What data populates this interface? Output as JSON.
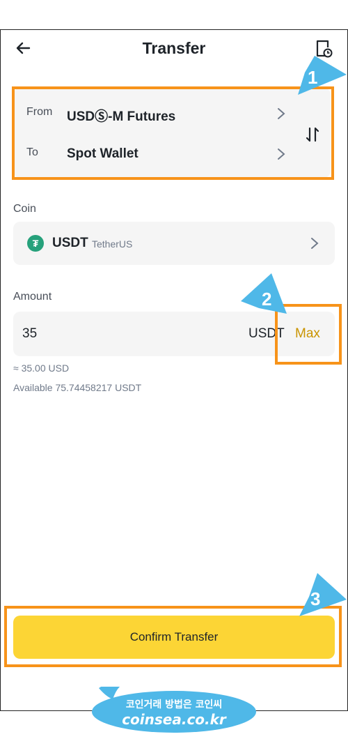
{
  "header": {
    "title": "Transfer",
    "back_icon": "arrow-left-icon",
    "history_icon": "history-icon"
  },
  "transfer": {
    "from_label": "From",
    "from_value": "USDⓈ-M Futures",
    "to_label": "To",
    "to_value": "Spot Wallet",
    "swap_icon": "swap-vertical-icon"
  },
  "coin": {
    "label": "Coin",
    "symbol": "USDT",
    "name": "TetherUS",
    "logo_glyph": "₮",
    "logo_color": "#26a17b"
  },
  "amount": {
    "label": "Amount",
    "value": "35",
    "unit": "USDT",
    "max_label": "Max",
    "approx": "≈ 35.00 USD",
    "available": "Available 75.74458217 USDT"
  },
  "confirm": {
    "label": "Confirm Transfer"
  },
  "callouts": [
    "1",
    "2",
    "3"
  ],
  "colors": {
    "accent": "#fcd535",
    "max": "#c99400",
    "highlight": "#f7931a",
    "callout": "#4fb8e8"
  }
}
